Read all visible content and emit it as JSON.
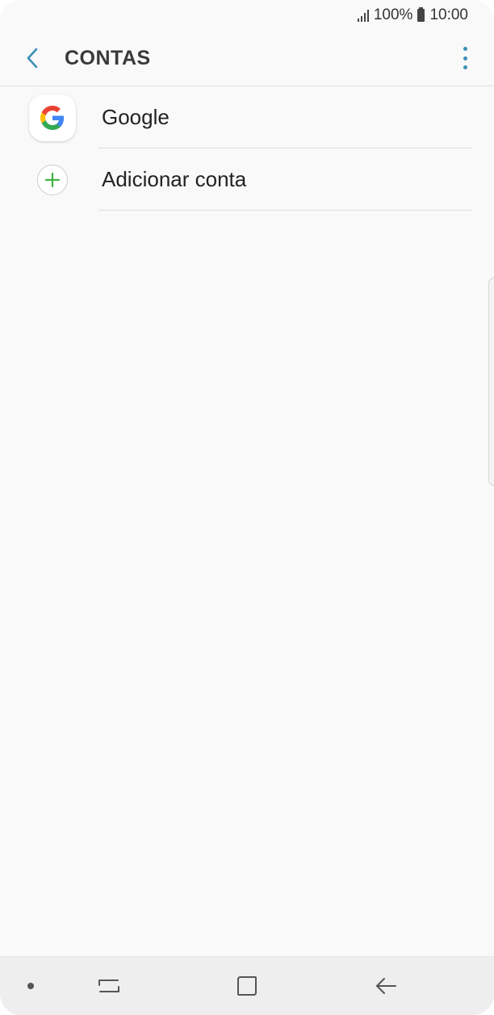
{
  "status_bar": {
    "battery": "100%",
    "time": "10:00"
  },
  "header": {
    "title": "CONTAS"
  },
  "accounts": [
    {
      "label": "Google",
      "icon": "google-icon"
    },
    {
      "label": "Adicionar conta",
      "icon": "plus-icon"
    }
  ],
  "colors": {
    "accent": "#3a8fb7",
    "plus_green": "#3fb13f",
    "background": "#f9f9f9"
  },
  "nav_bar": {
    "icons": [
      "dot-icon",
      "recents-icon",
      "home-icon",
      "back-arrow-icon"
    ]
  }
}
